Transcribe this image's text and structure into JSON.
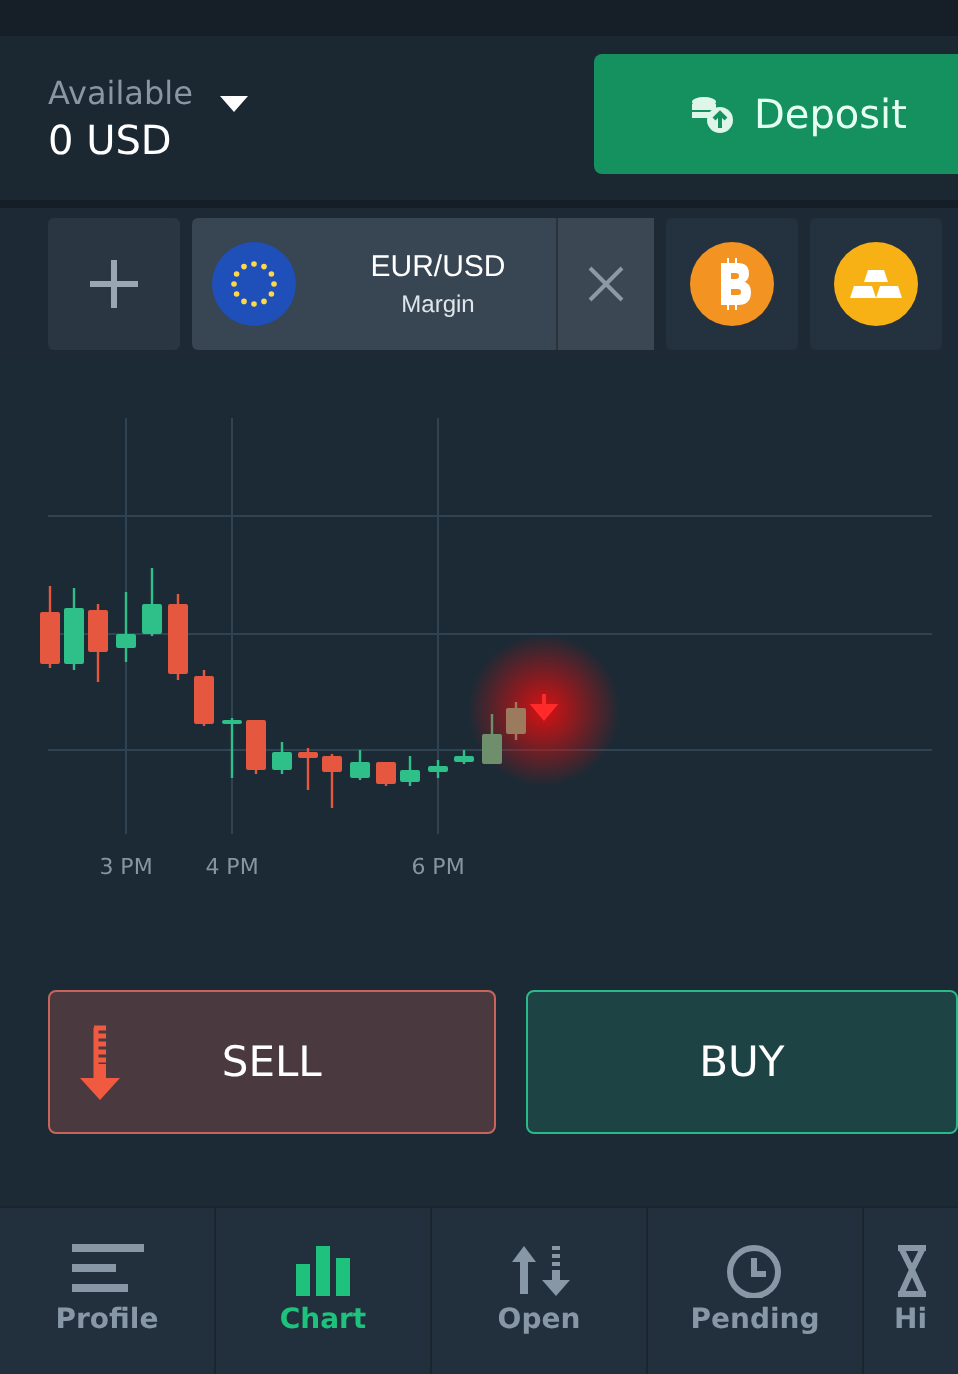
{
  "account": {
    "label": "Available",
    "balance": "0 USD"
  },
  "deposit_button": {
    "label": "Deposit"
  },
  "assets": [
    {
      "kind": "forex",
      "name": "EUR/USD",
      "type": "Margin",
      "selected": true
    },
    {
      "kind": "crypto",
      "selected": false
    },
    {
      "kind": "metal",
      "selected": false
    }
  ],
  "chart": {
    "time_labels": [
      "3 PM",
      "4 PM",
      "6 PM"
    ]
  },
  "trade_buttons": [
    {
      "kind": "sell",
      "label": "SELL"
    },
    {
      "kind": "buy",
      "label": "BUY"
    }
  ],
  "nav": [
    {
      "kind": "profile",
      "label": "Profile",
      "selected": false
    },
    {
      "kind": "chart",
      "label": "Chart",
      "selected": true
    },
    {
      "kind": "open",
      "label": "Open",
      "selected": false
    },
    {
      "kind": "pending",
      "label": "Pending",
      "selected": false
    },
    {
      "kind": "history",
      "label": "Hi",
      "selected": false
    }
  ]
}
